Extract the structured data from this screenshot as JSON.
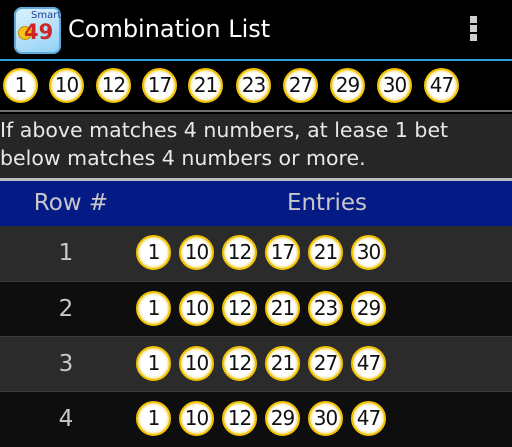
{
  "app": {
    "title": "Combination List",
    "icon_word": "Smart",
    "icon_number": "49"
  },
  "selected_numbers": [
    "1",
    "10",
    "12",
    "17",
    "21",
    "23",
    "27",
    "29",
    "30",
    "47"
  ],
  "notice": "If above matches 4 numbers, at lease 1 bet\nbelow matches 4 numbers or more.",
  "table": {
    "headers": {
      "row": "Row #",
      "entries": "Entries"
    },
    "rows": [
      {
        "row": "1",
        "entries": [
          "1",
          "10",
          "12",
          "17",
          "21",
          "30"
        ]
      },
      {
        "row": "2",
        "entries": [
          "1",
          "10",
          "12",
          "21",
          "23",
          "29"
        ]
      },
      {
        "row": "3",
        "entries": [
          "1",
          "10",
          "12",
          "21",
          "27",
          "47"
        ]
      },
      {
        "row": "4",
        "entries": [
          "1",
          "10",
          "12",
          "29",
          "30",
          "47"
        ]
      }
    ]
  },
  "colors": {
    "accent_line": "#2e9fd8",
    "header_background": "#041b86",
    "ball_ring": "#f2c200"
  }
}
